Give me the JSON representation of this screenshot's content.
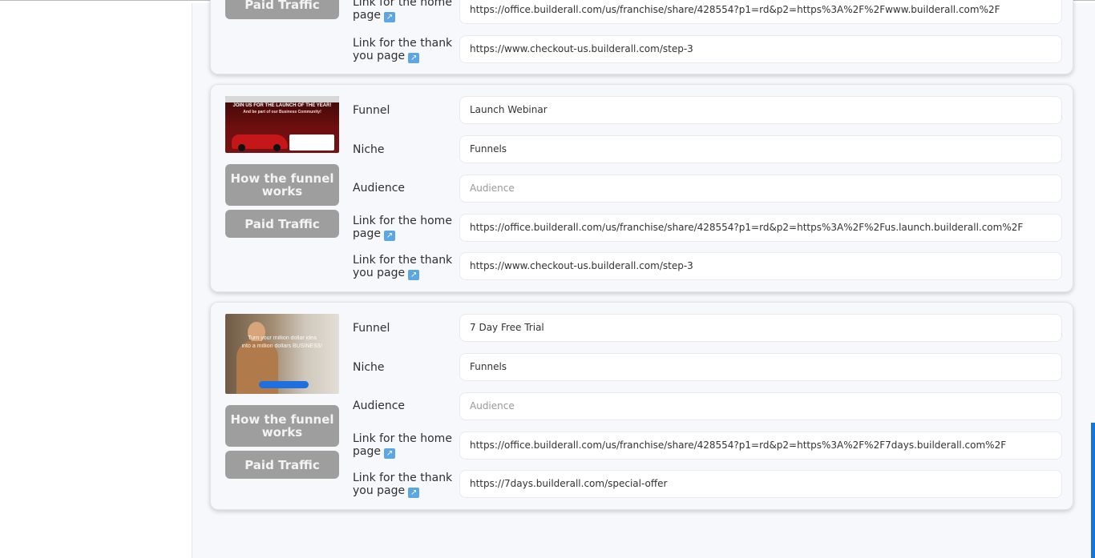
{
  "cards": [
    {
      "paid_label": "Paid Traffic",
      "labels": {
        "home": "Link for the home page",
        "thank": "Link for the thank you page"
      },
      "home_url": "https://office.builderall.com/us/franchise/share/428554?p1=rd&p2=https%3A%2F%2Fwww.builderall.com%2F",
      "thank_url": "https://www.checkout-us.builderall.com/step-3"
    },
    {
      "thumb": {
        "line1": "JOIN US FOR THE LAUNCH OF THE YEAR!",
        "line2": "And be part of our Business Community!"
      },
      "how_label": "How the funnel works",
      "paid_label": "Paid Traffic",
      "labels": {
        "funnel": "Funnel",
        "niche": "Niche",
        "audience": "Audience",
        "home": "Link for the home page",
        "thank": "Link for the thank you page"
      },
      "funnel": "Launch Webinar",
      "niche": "Funnels",
      "audience_placeholder": "Audience",
      "home_url": "https://office.builderall.com/us/franchise/share/428554?p1=rd&p2=https%3A%2F%2Fus.launch.builderall.com%2F",
      "thank_url": "https://www.checkout-us.builderall.com/step-3"
    },
    {
      "thumb": {
        "line1": "Turn your million dollar idea",
        "line2": "into a million dollars BUSINESS!"
      },
      "how_label": "How the funnel works",
      "paid_label": "Paid Traffic",
      "labels": {
        "funnel": "Funnel",
        "niche": "Niche",
        "audience": "Audience",
        "home": "Link for the home page",
        "thank": "Link for the thank you page"
      },
      "funnel": "7 Day Free Trial",
      "niche": "Funnels",
      "audience_placeholder": "Audience",
      "home_url": "https://office.builderall.com/us/franchise/share/428554?p1=rd&p2=https%3A%2F%2F7days.builderall.com%2F",
      "thank_url": "https://7days.builderall.com/special-offer"
    }
  ],
  "colors": {
    "button_gray": "#9e9e9e",
    "link_icon_blue": "#5aa6e6",
    "scroll_blue": "#1a73d9"
  },
  "icons": {
    "external_link": "external-link-icon"
  }
}
